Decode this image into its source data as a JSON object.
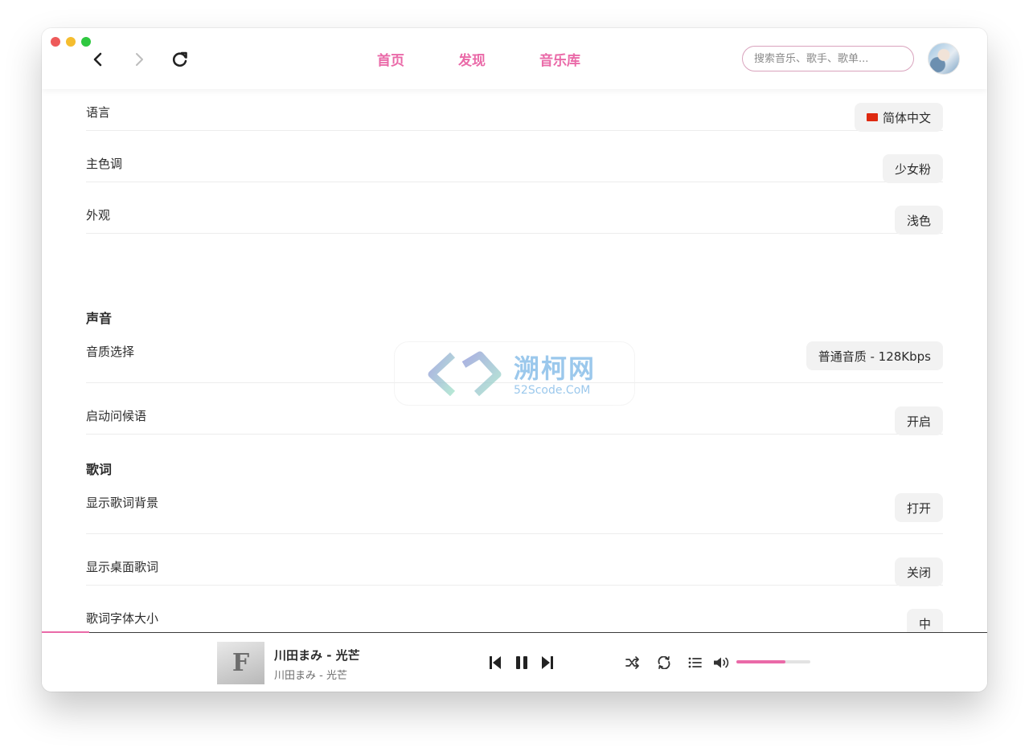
{
  "header": {
    "tabs": [
      {
        "label": "首页"
      },
      {
        "label": "发现"
      },
      {
        "label": "音乐库"
      }
    ],
    "search_placeholder": "搜索音乐、歌手、歌单..."
  },
  "settings": {
    "language": {
      "label": "语言",
      "value": "简体中文"
    },
    "theme_color": {
      "label": "主色调",
      "value": "少女粉"
    },
    "appearance": {
      "label": "外观",
      "value": "浅色"
    },
    "sound_section": "声音",
    "quality": {
      "label": "音质选择",
      "value": "普通音质 - 128Kbps"
    },
    "greeting": {
      "label": "启动问候语",
      "value": "开启"
    },
    "lyrics_section": "歌词",
    "lyrics_bg": {
      "label": "显示歌词背景",
      "value": "打开"
    },
    "desktop_lyrics": {
      "label": "显示桌面歌词",
      "value": "关闭"
    },
    "lyrics_font_size": {
      "label": "歌词字体大小",
      "value": "中"
    }
  },
  "watermark": {
    "cn": "溯柯网",
    "en": "52Scode.CoM"
  },
  "player": {
    "song_title": "川田まみ - 光芒",
    "song_artist": "川田まみ - 光芒",
    "cover_letter": "F",
    "progress": 0.05,
    "volume": 0.66
  },
  "colors": {
    "accent": "#ea6aa8"
  }
}
